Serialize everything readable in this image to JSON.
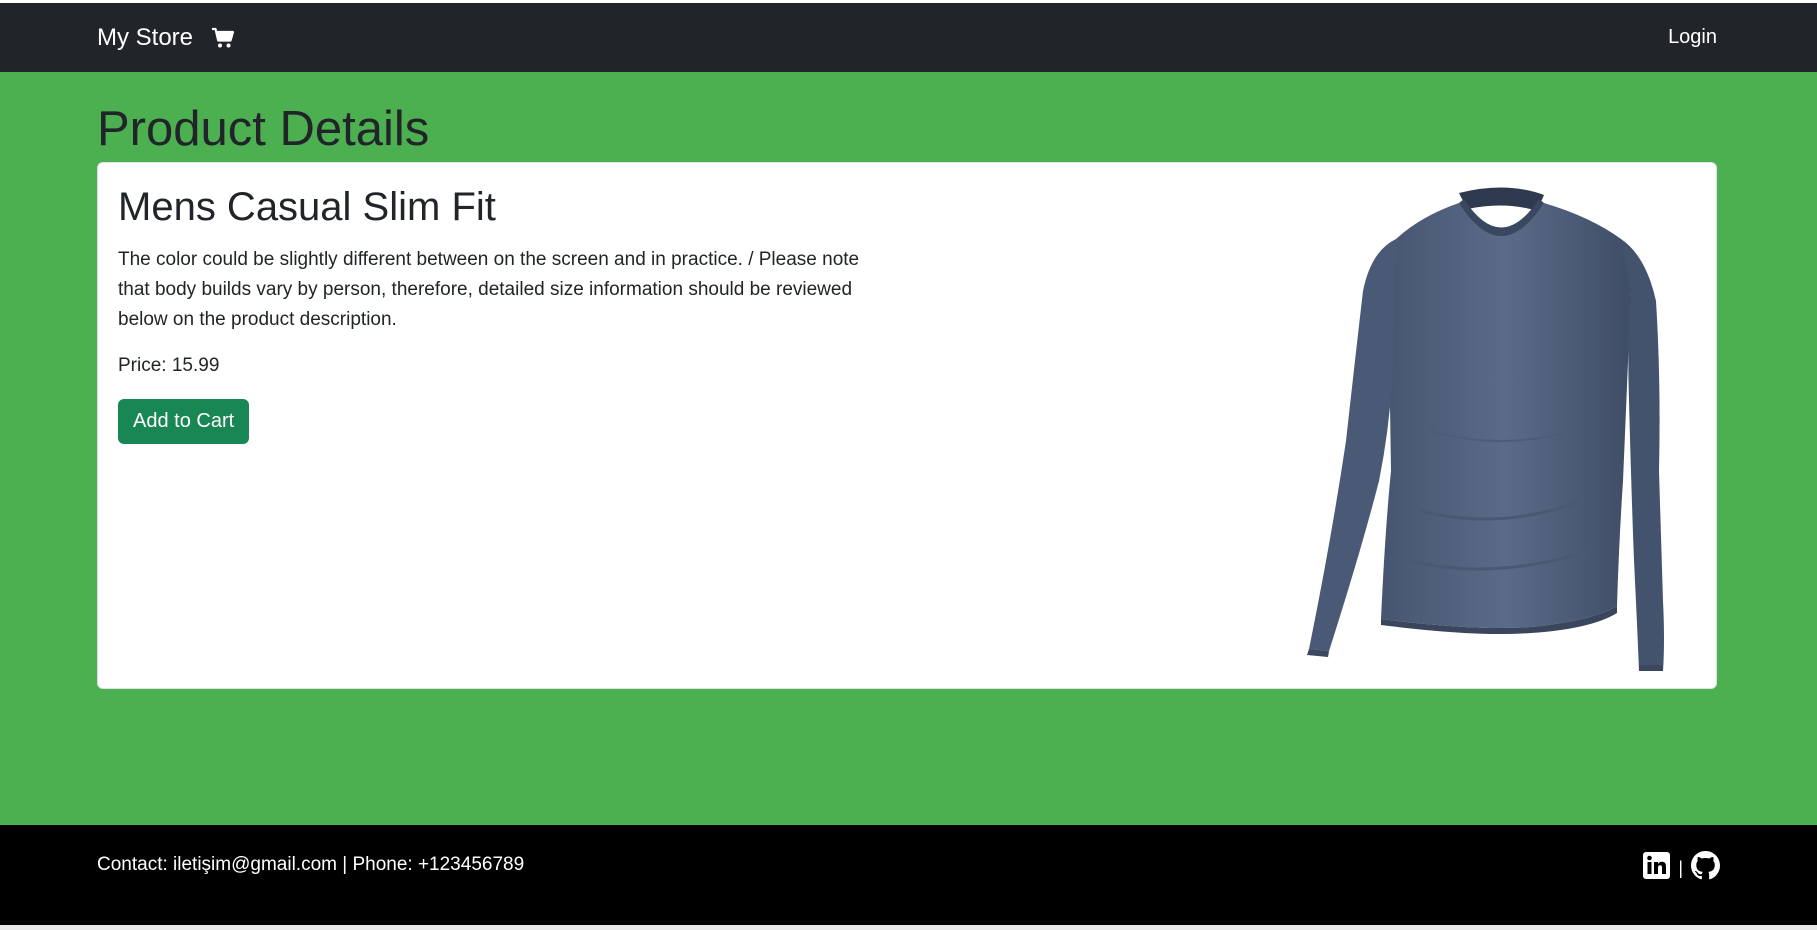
{
  "navbar": {
    "brand": "My Store",
    "cart_icon": "shopping-cart-icon",
    "login_label": "Login"
  },
  "main": {
    "title": "Product Details"
  },
  "product": {
    "title": "Mens Casual Slim Fit",
    "description": "The color could be slightly different between on the screen and in practice. / Please note that body builds vary by person, therefore, detailed size information should be reviewed below on the product description.",
    "price": "Price: 15.99",
    "add_to_cart_label": "Add to Cart",
    "image_icon": "long-sleeve-shirt-image"
  },
  "footer": {
    "contact": "Contact: iletişim@gmail.com | Phone: +123456789",
    "separator": "|",
    "linkedin_icon": "linkedin-icon",
    "github_icon": "github-icon"
  },
  "colors": {
    "navbar_bg": "#212529",
    "page_bg": "#4caf50",
    "button_bg": "#198754",
    "footer_bg": "#000000",
    "shirt": "#51617f"
  }
}
